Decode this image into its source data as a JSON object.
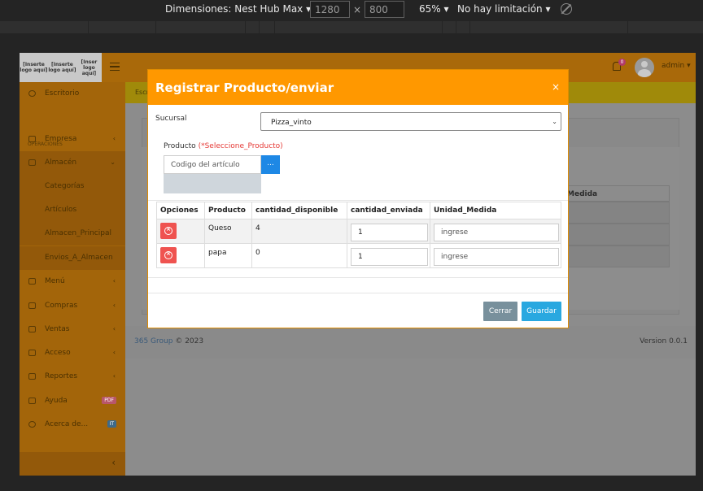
{
  "devtools": {
    "device_label": "Dimensiones: Nest Hub Max",
    "width": "1280",
    "height": "800",
    "zoom": "65%",
    "throttle": "No hay limitación",
    "times": "×"
  },
  "topbar": {
    "logo_parts": [
      "[Inserte logo aquí]",
      "[Inserte logo aquí]",
      "[Inser logo aquí]"
    ],
    "notification_count": "0",
    "user": "admin"
  },
  "sidebar": {
    "section_header": "OPERACIONES",
    "items": [
      {
        "label": "Escritorio",
        "icon": "dashboard-icon",
        "chevron": ""
      },
      {
        "label": "Empresa",
        "icon": "home-icon",
        "chevron": "‹"
      },
      {
        "label": "Almacén",
        "icon": "box-icon",
        "chevron": "⌄"
      },
      {
        "label": "Categorías",
        "icon": "",
        "chevron": ""
      },
      {
        "label": "Artículos",
        "icon": "",
        "chevron": ""
      },
      {
        "label": "Almacen_Principal",
        "icon": "",
        "chevron": ""
      },
      {
        "label": "Envios_A_Almacen",
        "icon": "",
        "chevron": ""
      },
      {
        "label": "Menú",
        "icon": "menu-icon",
        "chevron": "‹"
      },
      {
        "label": "Compras",
        "icon": "cart-icon",
        "chevron": "‹"
      },
      {
        "label": "Ventas",
        "icon": "sales-icon",
        "chevron": "‹"
      },
      {
        "label": "Acceso",
        "icon": "lock-icon",
        "chevron": "‹"
      },
      {
        "label": "Reportes",
        "icon": "report-icon",
        "chevron": "‹"
      },
      {
        "label": "Ayuda",
        "icon": "help-icon",
        "badge": "PDF"
      },
      {
        "label": "Acerca de...",
        "icon": "info-icon",
        "badge": "IT"
      }
    ],
    "collapse_glyph": "‹"
  },
  "content": {
    "breadcrumb": "Escr",
    "bg_table_header": "da_Medida"
  },
  "footer": {
    "company": "365 Group",
    "copyright": "© 2023",
    "version": "Version 0.0.1"
  },
  "modal": {
    "title": "Registrar Producto/enviar",
    "close": "×",
    "sucursal_label": "Sucursal",
    "sucursal_value": "Pizza_vinto",
    "producto_label": "Producto",
    "producto_hint": "(*Seleccione_Producto)",
    "codigo_placeholder": "Codigo del artículo",
    "codigo_button": "...",
    "table": {
      "headers": [
        "Opciones",
        "Producto",
        "cantidad_disponible",
        "cantidad_enviada",
        "Unidad_Medida"
      ],
      "rows": [
        {
          "producto": "Queso",
          "disponible": "4",
          "enviada": "1",
          "unidad": "ingrese"
        },
        {
          "producto": "papa",
          "disponible": "0",
          "enviada": "1",
          "unidad": "ingrese"
        }
      ]
    },
    "cancel_label": "Cerrar",
    "save_label": "Guardar"
  },
  "colors": {
    "modal_header": "#ff9800",
    "save_button": "#29a8e0",
    "cancel_button": "#78909c",
    "delete_button": "#ef5350",
    "required_hint": "#e53935"
  }
}
